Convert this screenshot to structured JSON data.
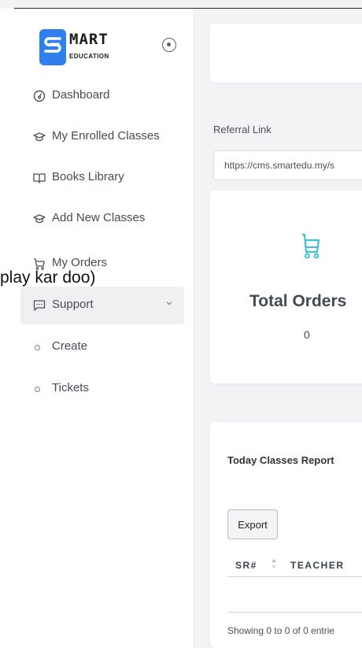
{
  "logo": {
    "title": "MART",
    "subtitle": "EDUCATION"
  },
  "sidebar": {
    "items": [
      {
        "label": "Dashboard",
        "icon": "dashboard-icon"
      },
      {
        "label": "My Enrolled Classes",
        "icon": "graduation-cap-icon"
      },
      {
        "label": "Books Library",
        "icon": "book-icon"
      },
      {
        "label": "Add New Classes",
        "icon": "graduation-cap-icon"
      },
      {
        "label": "My Orders",
        "icon": "cart-icon"
      },
      {
        "label": "Support",
        "icon": "chat-icon"
      }
    ],
    "support_children": [
      {
        "label": "Create"
      },
      {
        "label": "Tickets"
      }
    ]
  },
  "overlay_text": "play kar doo)",
  "referral": {
    "label": "Referral Link",
    "value": "https://cms.smartedu.my/s"
  },
  "orders": {
    "title": "Total Orders",
    "value": "0",
    "icon": "cart-icon",
    "icon_color": "#3ec1d3"
  },
  "report": {
    "title": "Today Classes Report",
    "export_label": "Export",
    "columns": [
      "SR#",
      "TEACHER"
    ],
    "footer": "Showing 0 to 0 of 0 entrie"
  },
  "colors": {
    "brand": "#2f80ed",
    "accent": "#3ec1d3"
  }
}
